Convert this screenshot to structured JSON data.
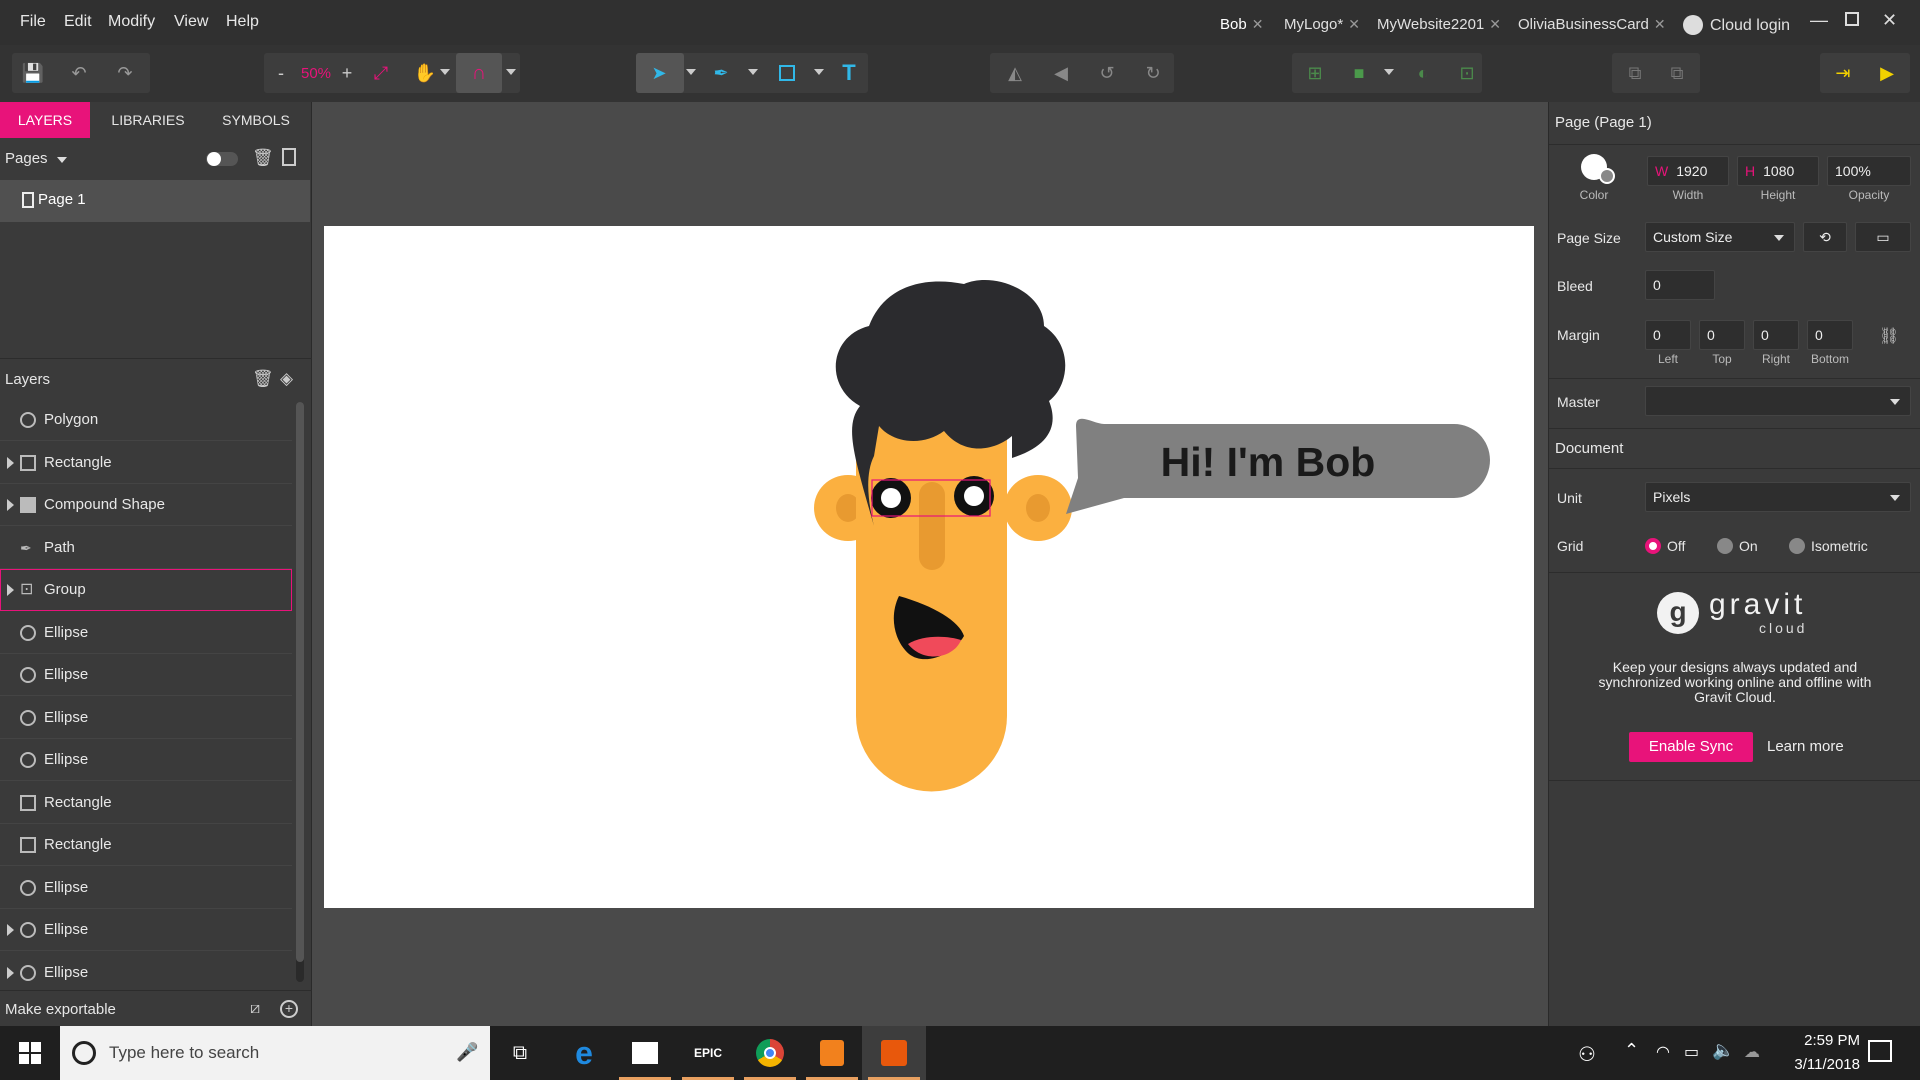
{
  "menu": [
    "File",
    "Edit",
    "Modify",
    "View",
    "Help"
  ],
  "doc_tabs": [
    {
      "label": "Bob",
      "active": true
    },
    {
      "label": "MyLogo*",
      "active": false
    },
    {
      "label": "MyWebsite2201",
      "active": false
    },
    {
      "label": "OliviaBusinessCard",
      "active": false
    }
  ],
  "cloud_login": "Cloud login",
  "toolbar": {
    "zoom_minus": "-",
    "zoom": "50%",
    "zoom_plus": "+"
  },
  "left_tabs": [
    "LAYERS",
    "LIBRARIES",
    "SYMBOLS"
  ],
  "pages": {
    "label": "Pages",
    "items": [
      "Page 1"
    ]
  },
  "layers": {
    "label": "Layers",
    "items": [
      {
        "name": "Polygon",
        "icon": "polygon-icon",
        "expandable": false,
        "selected": false
      },
      {
        "name": "Rectangle",
        "icon": "rectangle-icon",
        "expandable": true,
        "selected": false
      },
      {
        "name": "Compound Shape",
        "icon": "compound-shape-icon",
        "expandable": true,
        "selected": false
      },
      {
        "name": "Path",
        "icon": "pen-icon",
        "expandable": false,
        "selected": false
      },
      {
        "name": "Group",
        "icon": "group-icon",
        "expandable": true,
        "selected": true
      },
      {
        "name": "Ellipse",
        "icon": "ellipse-icon",
        "expandable": false,
        "selected": false
      },
      {
        "name": "Ellipse",
        "icon": "ellipse-icon",
        "expandable": false,
        "selected": false
      },
      {
        "name": "Ellipse",
        "icon": "ellipse-icon",
        "expandable": false,
        "selected": false
      },
      {
        "name": "Ellipse",
        "icon": "ellipse-icon",
        "expandable": false,
        "selected": false
      },
      {
        "name": "Rectangle",
        "icon": "rectangle-icon",
        "expandable": false,
        "selected": false
      },
      {
        "name": "Rectangle",
        "icon": "rectangle-icon",
        "expandable": false,
        "selected": false
      },
      {
        "name": "Ellipse",
        "icon": "ellipse-icon",
        "expandable": false,
        "selected": false
      },
      {
        "name": "Ellipse",
        "icon": "ellipse-icon",
        "expandable": true,
        "selected": false
      },
      {
        "name": "Ellipse",
        "icon": "ellipse-icon",
        "expandable": true,
        "selected": false
      }
    ]
  },
  "make_exportable": "Make exportable",
  "canvas": {
    "speech_text": "Hi! I'm Bob"
  },
  "right": {
    "title": "Page (Page 1)",
    "color_label": "Color",
    "width_prefix": "W",
    "width": "1920",
    "width_label": "Width",
    "height_prefix": "H",
    "height": "1080",
    "height_label": "Height",
    "opacity": "100%",
    "opacity_label": "Opacity",
    "page_size_label": "Page Size",
    "page_size": "Custom Size",
    "bleed_label": "Bleed",
    "bleed": "0",
    "margin_label": "Margin",
    "margins": [
      {
        "value": "0",
        "label": "Left"
      },
      {
        "value": "0",
        "label": "Top"
      },
      {
        "value": "0",
        "label": "Right"
      },
      {
        "value": "0",
        "label": "Bottom"
      }
    ],
    "master_label": "Master",
    "master": "",
    "document_label": "Document",
    "unit_label": "Unit",
    "unit": "Pixels",
    "grid_label": "Grid",
    "grid_options": [
      {
        "label": "Off",
        "selected": true
      },
      {
        "label": "On",
        "selected": false
      },
      {
        "label": "Isometric",
        "selected": false
      }
    ],
    "gravit_word": "gravit",
    "gravit_sub": "cloud",
    "promo": "Keep your designs always updated and synchronized working online and offline with Gravit Cloud.",
    "enable_sync": "Enable Sync",
    "learn_more": "Learn more"
  },
  "taskbar": {
    "search_placeholder": "Type here to search",
    "time": "2:59 PM",
    "date": "3/11/2018"
  },
  "colors": {
    "accent": "#e8137a",
    "face": "#fbb040",
    "hair": "#2b2b2e",
    "bubble": "#808080"
  }
}
